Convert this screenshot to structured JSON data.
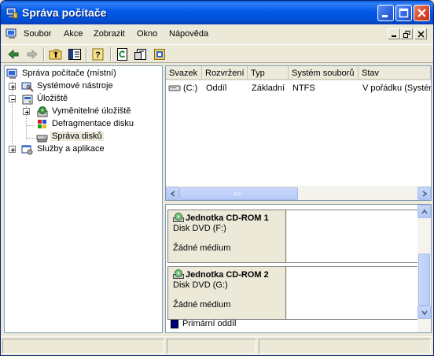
{
  "window": {
    "title": "Správa počítače",
    "title_icon": "computer-management-icon",
    "controls": [
      "minimize-icon",
      "maximize-icon",
      "close-icon"
    ]
  },
  "menubar": {
    "items": [
      "Soubor",
      "Akce",
      "Zobrazit",
      "Okno",
      "Nápověda"
    ],
    "mdi_controls": [
      "minimize-icon",
      "restore-icon",
      "close-icon"
    ]
  },
  "toolbar": {
    "buttons": [
      "back-arrow-icon",
      "forward-arrow-icon",
      "up-folder-icon",
      "show-hide-tree-icon",
      "help-icon",
      "refresh-icon",
      "properties-icon",
      "export-list-icon"
    ]
  },
  "tree": {
    "root": "Správa počítače (místní)",
    "items": [
      {
        "label": "Systémové nástroje",
        "expander": "+",
        "level": 1
      },
      {
        "label": "Úložiště",
        "expander": "-",
        "level": 1
      },
      {
        "label": "Vyměnitelné úložiště",
        "expander": "+",
        "level": 2
      },
      {
        "label": "Defragmentace disku",
        "expander": "",
        "level": 2
      },
      {
        "label": "Správa disků",
        "expander": "",
        "level": 2,
        "selected": true
      },
      {
        "label": "Služby a aplikace",
        "expander": "+",
        "level": 1
      }
    ]
  },
  "volume_list": {
    "columns": [
      "Svazek",
      "Rozvržení",
      "Typ",
      "Systém souborů",
      "Stav"
    ],
    "rows": [
      [
        "(C:)",
        "Oddíl",
        "Základní",
        "NTFS",
        "V pořádku (Systém"
      ]
    ]
  },
  "disks": [
    {
      "name": "Jednotka CD-ROM 1",
      "type": "Disk DVD (F:)",
      "status": "Žádné médium"
    },
    {
      "name": "Jednotka CD-ROM 2",
      "type": "Disk DVD (G:)",
      "status": "Žádné médium"
    }
  ],
  "legend": {
    "label": "Primární oddíl",
    "color": "#000080"
  },
  "colors": {
    "titlebar": "#0058e6",
    "window_bg": "#ece9d8",
    "pane_border": "#7f9db9"
  }
}
